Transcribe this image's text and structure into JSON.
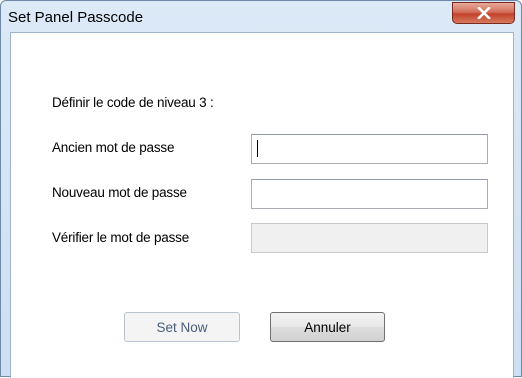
{
  "window": {
    "title": "Set Panel Passcode"
  },
  "form": {
    "heading": "Définir le code de niveau 3 :",
    "old_password_label": "Ancien mot de passe",
    "old_password_value": "",
    "new_password_label": "Nouveau mot de passe",
    "new_password_value": "",
    "verify_password_label": "Vérifier le mot de passe",
    "verify_password_value": ""
  },
  "buttons": {
    "set_now": "Set Now",
    "cancel": "Annuler"
  },
  "icons": {
    "close": "close-icon"
  },
  "colors": {
    "titlebar": "#d4e4f5",
    "close_button": "#c9503b"
  }
}
